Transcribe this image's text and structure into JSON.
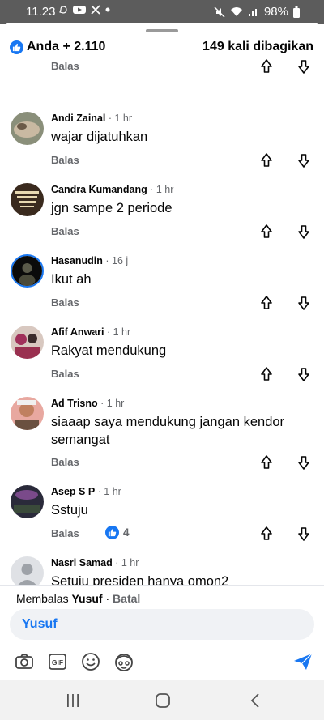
{
  "status_bar": {
    "time": "11.23",
    "battery": "98%",
    "icons": [
      "whatsapp-icon",
      "youtube-icon",
      "x-icon",
      "dot-icon",
      "mute-icon",
      "wifi-icon",
      "signal-icon",
      "battery-icon"
    ]
  },
  "reactions": {
    "reactors": "Anda + 2.110",
    "shares": "149 kali dibagikan"
  },
  "reply_label": "Balas",
  "comments": [
    {
      "name": "Andi Zainal",
      "time": " · 1 hr",
      "text": "wajar dijatuhkan"
    },
    {
      "name": "Candra Kumandang",
      "time": " · 1 hr",
      "text": "jgn sampe 2 periode"
    },
    {
      "name": "Hasanudin",
      "time": " · 16 j",
      "text": "Ikut ah"
    },
    {
      "name": "Afif Anwari",
      "time": " · 1 hr",
      "text": "Rakyat mendukung"
    },
    {
      "name": "Ad Trisno",
      "time": " · 1 hr",
      "text": "siaaap saya mendukung jangan kendor semangat"
    },
    {
      "name": "Asep S P",
      "time": " · 1 hr",
      "text": "Sstuju",
      "like_count": "4"
    },
    {
      "name": "Nasri Samad",
      "time": " · 1 hr",
      "text": "Setuju presiden hanya omon2"
    }
  ],
  "composer": {
    "replying_to_prefix": "Membalas ",
    "replying_to_name": "Yusuf",
    "separator": " · ",
    "cancel_label": "Batal",
    "input_value": "Yusuf",
    "gif_label": "GIF"
  },
  "colors": {
    "accent": "#1877f2",
    "secondary_text": "#65676b",
    "status_bar": "#5c5c5c"
  }
}
